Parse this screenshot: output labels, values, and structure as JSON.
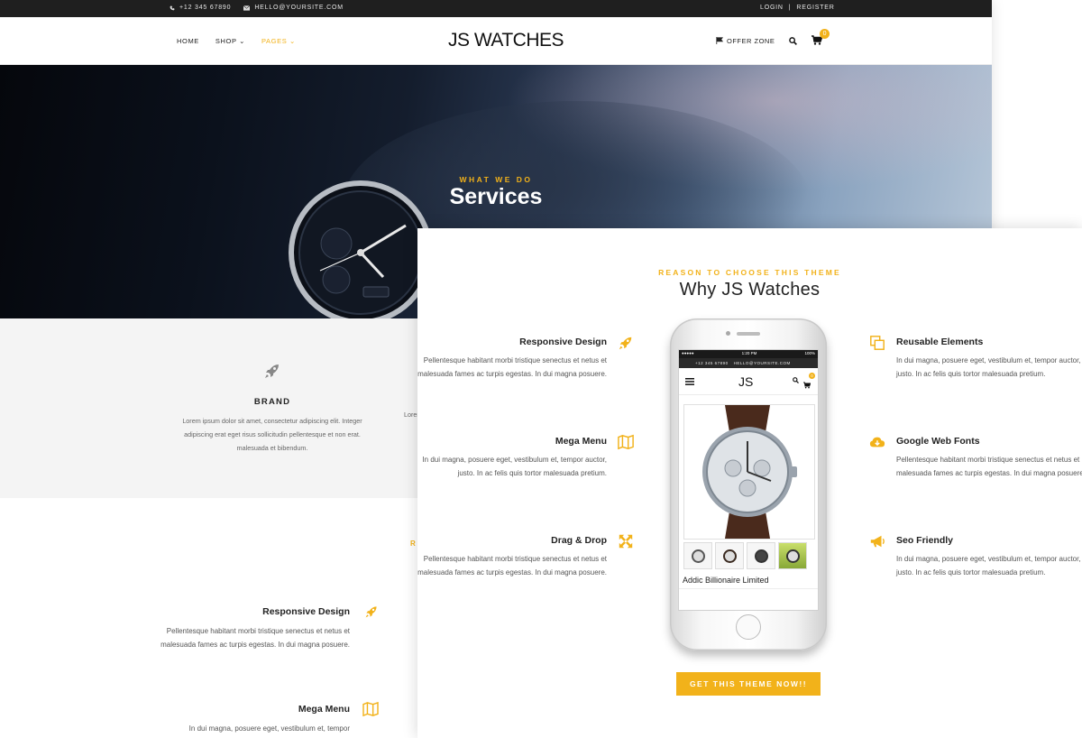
{
  "back": {
    "topbar": {
      "phone": "+12 345 67890",
      "email": "HELLO@YOURSITE.COM",
      "login": "LOGIN",
      "separator": "|",
      "register": "REGISTER"
    },
    "nav": {
      "items": [
        {
          "label": "HOME",
          "active": false
        },
        {
          "label": "SHOP",
          "active": false
        },
        {
          "label": "PAGES",
          "active": true
        }
      ],
      "logo": "JS WATCHES",
      "offer_zone": "OFFER ZONE",
      "cart_count": "0"
    },
    "hero": {
      "subtitle": "WHAT WE DO",
      "title": "Services"
    },
    "services": [
      {
        "icon": "rocket-icon",
        "title": "BRAND",
        "description": "Lorem ipsum dolor sit amet, consectetur adipiscing elit. Integer adipiscing erat eget risus sollicitudin pellentesque et non erat. malesuada et bibendum."
      }
    ],
    "peek_text": "Lorem",
    "peek_heading": "R",
    "features": [
      {
        "title": "Responsive Design",
        "icon": "rocket-icon",
        "description": "Pellentesque habitant morbi tristique senectus et netus et malesuada fames ac turpis egestas. In dui magna posuere."
      },
      {
        "title": "Mega Menu",
        "icon": "map-icon",
        "description": "In dui magna, posuere eget, vestibulum et, tempor"
      }
    ]
  },
  "front": {
    "subtitle": "REASON TO CHOOSE THIS THEME",
    "title": "Why JS Watches",
    "left_features": [
      {
        "title": "Responsive Design",
        "icon": "rocket-icon",
        "description": "Pellentesque habitant morbi tristique senectus et netus et malesuada fames ac turpis egestas. In dui magna posuere."
      },
      {
        "title": "Mega Menu",
        "icon": "map-icon",
        "description": "In dui magna, posuere eget, vestibulum et, tempor auctor, justo. In ac felis quis tortor malesuada pretium."
      },
      {
        "title": "Drag & Drop",
        "icon": "expand-icon",
        "description": "Pellentesque habitant morbi tristique senectus et netus et malesuada fames ac turpis egestas. In dui magna posuere."
      }
    ],
    "right_features": [
      {
        "title": "Reusable Elements",
        "icon": "copy-icon",
        "description": "In dui magna, posuere eget, vestibulum et, tempor auctor, justo. In ac felis quis tortor malesuada pretium."
      },
      {
        "title": "Google Web Fonts",
        "icon": "cloud-download-icon",
        "description": "Pellentesque habitant morbi tristique senectus et netus et malesuada fames ac turpis egestas. In dui magna posuere."
      },
      {
        "title": "Seo Friendly",
        "icon": "megaphone-icon",
        "description": "In dui magna, posuere eget, vestibulum et, tempor auctor, justo. In ac felis quis tortor malesuada pretium."
      }
    ],
    "cta_label": "GET THIS THEME NOW!!",
    "phone": {
      "status_left": "●●●●● ",
      "status_time": "1:20 PM",
      "status_right": "100%",
      "top_phone": "+12 345 67890",
      "top_email": "HELLO@YOURSITE.COM",
      "logo": "JS",
      "cart_count": "0",
      "product_name": "Addic Billionaire Limited"
    }
  },
  "colors": {
    "accent": "#f2b21a",
    "topbar": "#1f1f1f",
    "text": "#222222"
  }
}
